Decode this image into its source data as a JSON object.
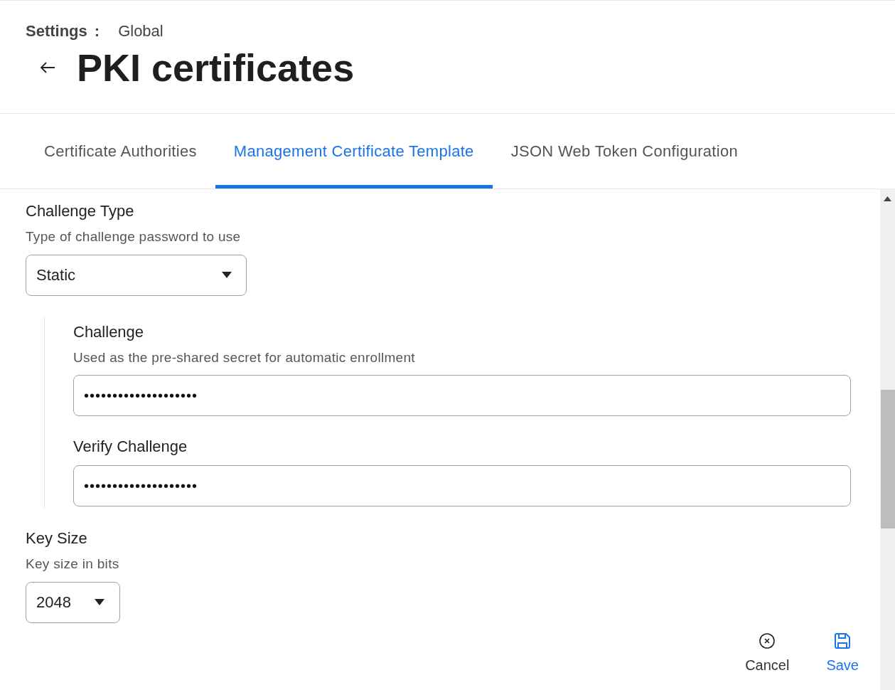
{
  "breadcrumb": {
    "section": "Settings",
    "separator": ":",
    "scope": "Global"
  },
  "title": "PKI certificates",
  "tabs": [
    {
      "label": "Certificate Authorities",
      "selected": false
    },
    {
      "label": "Management Certificate Template",
      "selected": true
    },
    {
      "label": "JSON Web Token Configuration",
      "selected": false
    }
  ],
  "challenge_type": {
    "label": "Challenge Type",
    "description": "Type of challenge password to use",
    "value": "Static"
  },
  "challenge_group": [
    {
      "label": "Challenge",
      "description": "Used as the pre-shared secret for automatic enrollment",
      "value": "••••••••••••••••••••"
    },
    {
      "label": "Verify Challenge",
      "value": "••••••••••••••••••••"
    }
  ],
  "key_size": {
    "label": "Key Size",
    "description": "Key size in bits",
    "value": "2048"
  },
  "actions": [
    {
      "kind": "cancel",
      "label": "Cancel"
    },
    {
      "kind": "save",
      "label": "Save"
    }
  ]
}
